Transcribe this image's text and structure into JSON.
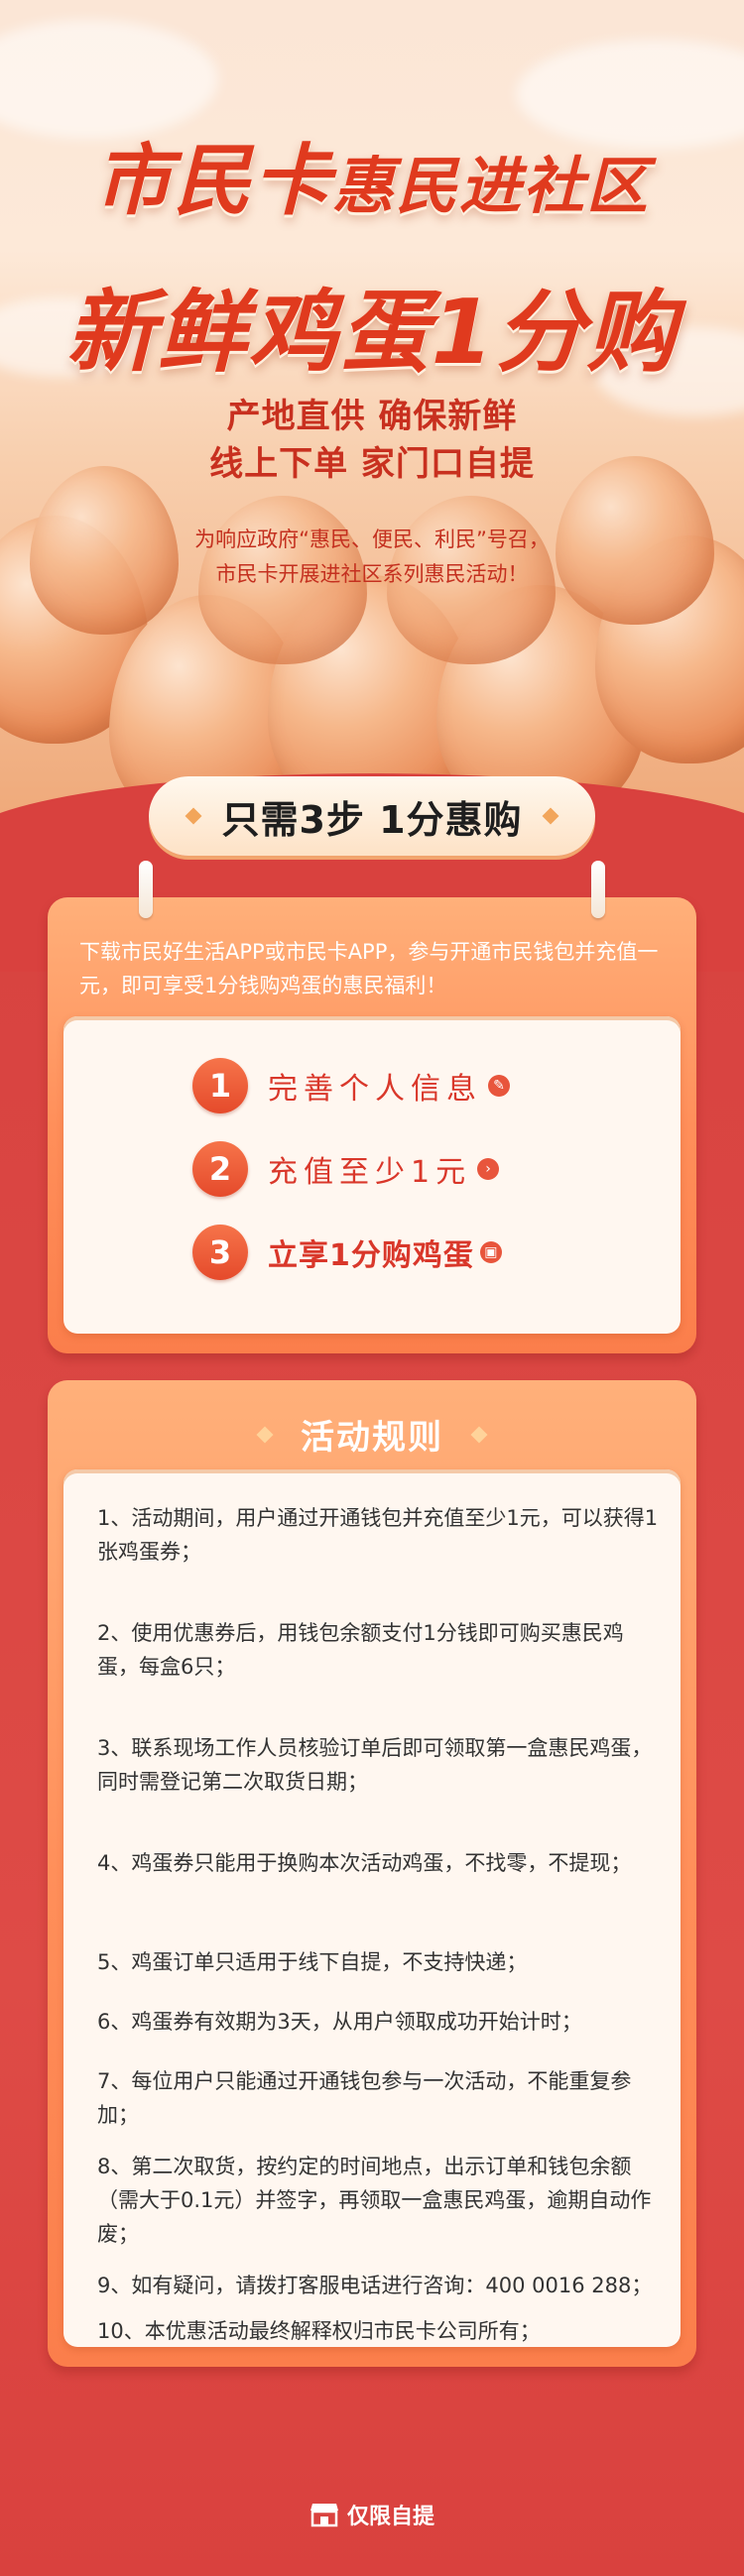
{
  "hero": {
    "title_line1_big": "市民卡",
    "title_line1_small": "惠民进社区",
    "title_line2": "新鲜鸡蛋1分购",
    "subtitle_line1": "产地直供 确保新鲜",
    "subtitle_line2": "线上下单 家门口自提",
    "intro_line1": "为响应政府“惠民、便民、利民”号召，",
    "intro_line2": "市民卡开展进社区系列惠民活动！"
  },
  "steps_banner": {
    "label": "只需3步 1分惠购"
  },
  "steps_card": {
    "description": "下载市民好生活APP或市民卡APP，参与开通市民钱包并充值一元，即可享受1分钱购鸡蛋的惠民福利！",
    "steps": [
      {
        "number": "1",
        "label": "完善个人信息",
        "icon": "edit-icon"
      },
      {
        "number": "2",
        "label": "充值至少1元",
        "icon": "arrow-icon"
      },
      {
        "number": "3",
        "label": "立享1分购鸡蛋",
        "icon": "coupon-icon"
      }
    ]
  },
  "rules_card": {
    "title": "活动规则",
    "rules": [
      "1、活动期间，用户通过开通钱包并充值至少1元，可以获得1张鸡蛋券；",
      "2、使用优惠券后，用钱包余额支付1分钱即可购买惠民鸡蛋，每盒6只；",
      "3、联系现场工作人员核验订单后即可领取第一盒惠民鸡蛋，同时需登记第二次取货日期；",
      "4、鸡蛋券只能用于换购本次活动鸡蛋，不找零，不提现；",
      "5、鸡蛋订单只适用于线下自提，不支持快递；",
      "6、鸡蛋券有效期为3天，从用户领取成功开始计时；",
      "7、每位用户只能通过开通钱包参与一次活动，不能重复参加；",
      "8、第二次取货，按约定的时间地点，出示订单和钱包余额（需大于0.1元）并签字，再领取一盒惠民鸡蛋，逾期自动作废；",
      "9、如有疑问，请拨打客服电话进行咨询：400 0016 288；",
      "10、本优惠活动最终解释权归市民卡公司所有；"
    ]
  },
  "footer": {
    "label": "仅限自提",
    "icon": "shop-icon"
  },
  "colors": {
    "accent_red": "#e03a1e",
    "page_red": "#d84340",
    "orange": "#ff8f5a"
  }
}
